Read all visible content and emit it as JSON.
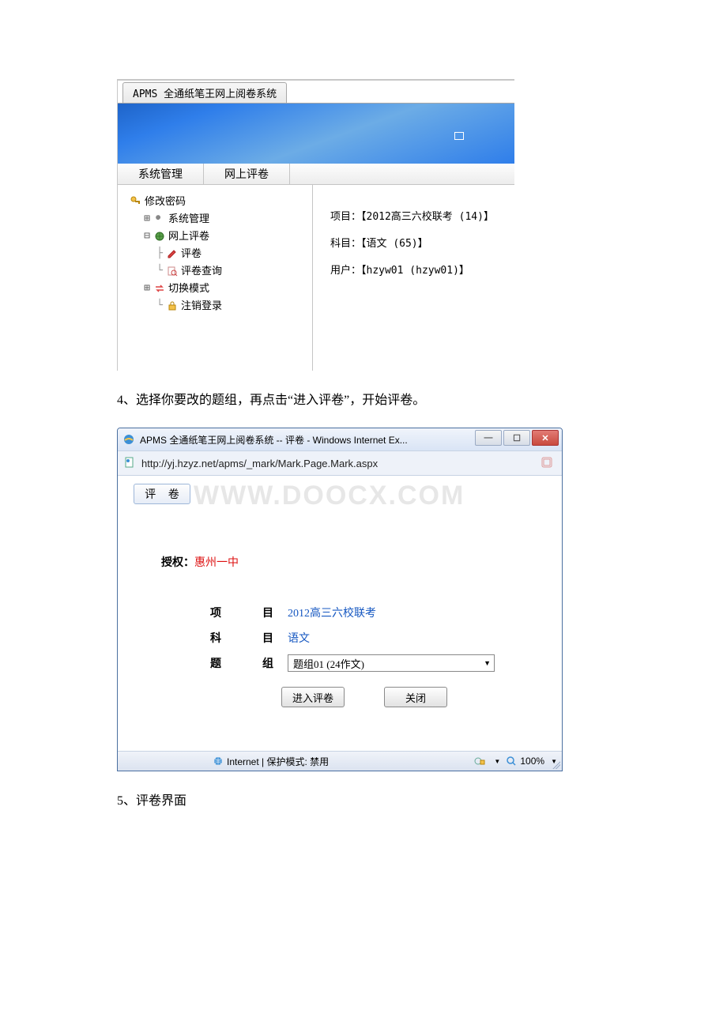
{
  "apms": {
    "tab_title": "APMS 全通纸笔王网上阅卷系统",
    "menubar": {
      "item0": "系统管理",
      "item1": "网上评卷"
    },
    "tree": {
      "header": "修改密码",
      "n0": "系统管理",
      "n1": "网上评卷",
      "n1_0": "评卷",
      "n1_1": "评卷查询",
      "n2": "切换模式",
      "n3": "注销登录"
    },
    "info": {
      "row0": "项目：【2012高三六校联考 (14)】",
      "row1": "科目：【语文 (65)】",
      "row2": "用户：【hzyw01 (hzyw01)】"
    }
  },
  "step4": "4、选择你要改的题组，再点击“进入评卷”，开始评卷。",
  "ie": {
    "title": "APMS 全通纸笔王网上阅卷系统 -- 评卷 - Windows Internet Ex...",
    "url": "http://yj.hzyz.net/apms/_mark/Mark.Page.Mark.aspx",
    "watermark": "WWW.DOOCX.COM",
    "tab_label": "评 卷",
    "auth_label": "授权：",
    "auth_value": "惠州一中",
    "fields": {
      "project_label": "项　　目",
      "project_value": "2012高三六校联考",
      "subject_label": "科　　目",
      "subject_value": "语文",
      "group_label": "题　　组",
      "group_value": "题组01 (24作文)"
    },
    "buttons": {
      "enter": "进入评卷",
      "close": "关闭"
    },
    "status": {
      "zone": "Internet | 保护模式: 禁用",
      "zoom": "100%"
    }
  },
  "step5": "5、评卷界面"
}
